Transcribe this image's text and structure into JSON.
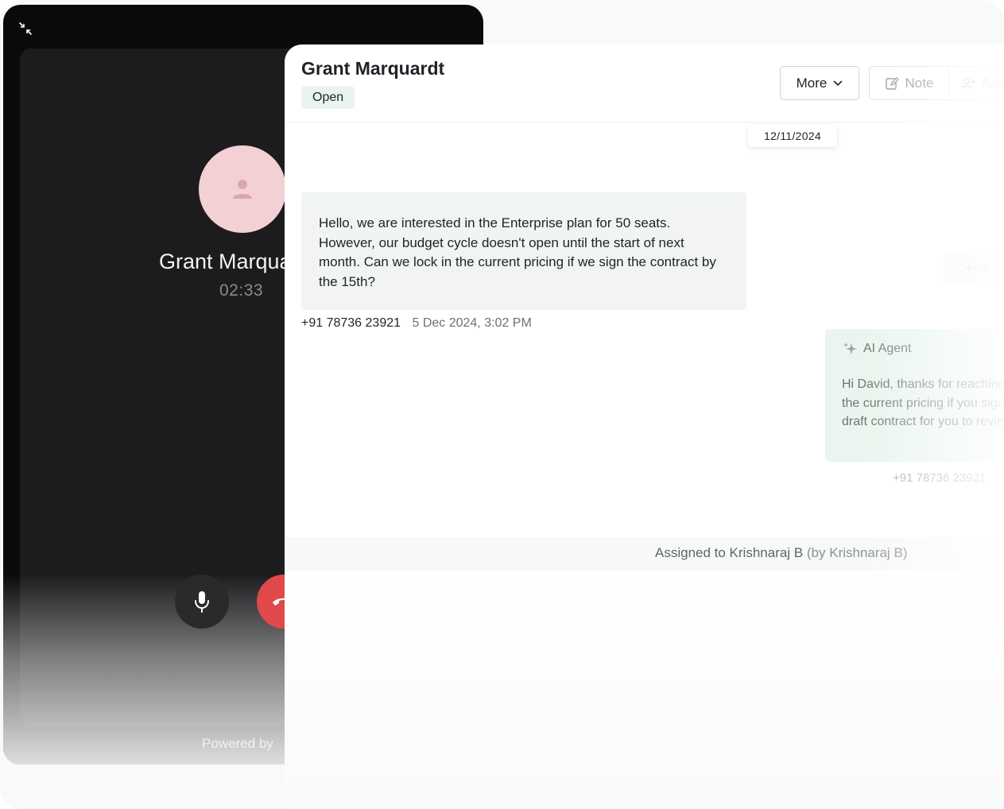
{
  "call": {
    "caller_name": "Grant Marquardt",
    "timer": "02:33",
    "powered_by": "Powered by"
  },
  "conversation": {
    "contact_name": "Grant Marquardt",
    "status": "Open",
    "actions": {
      "more_label": "More",
      "note_label": "Note",
      "assign_label": "Assign"
    },
    "date_chip": "12/11/2024",
    "incoming_message": {
      "text": "Hello, we are interested in the Enterprise plan for 50 seats. However, our budget cycle doesn't open until the start of next month. Can we lock in the current pricing if we sign the contract by the 15th?",
      "phone": "+91 78736 23921",
      "timestamp": "5 Dec 2024, 3:02 PM"
    },
    "ghost_chip_label": "A",
    "ai_reply": {
      "sender": "AI Agent",
      "text": "Hi David, thanks for reaching out. We can definitely hold the current pricing if you sign by the 15th. I'll send over a draft contract for you to review in the meantime.",
      "phone": "+91 78736 23921"
    },
    "assignment": {
      "text": "Assigned to Krishnaraj B",
      "by": "(by Krishnaraj B)"
    }
  },
  "colors": {
    "status_badge_bg": "#e9f4ef",
    "hangup_red": "#e0484a",
    "avatar_pink": "#f3d0d4",
    "ai_bubble_bg": "#e9f5ee"
  },
  "icons": [
    "minimize-icon",
    "user-icon",
    "microphone-icon",
    "phone-hangup-icon",
    "chevron-down-icon",
    "edit-note-icon",
    "user-plus-icon",
    "sparkle-icon"
  ]
}
